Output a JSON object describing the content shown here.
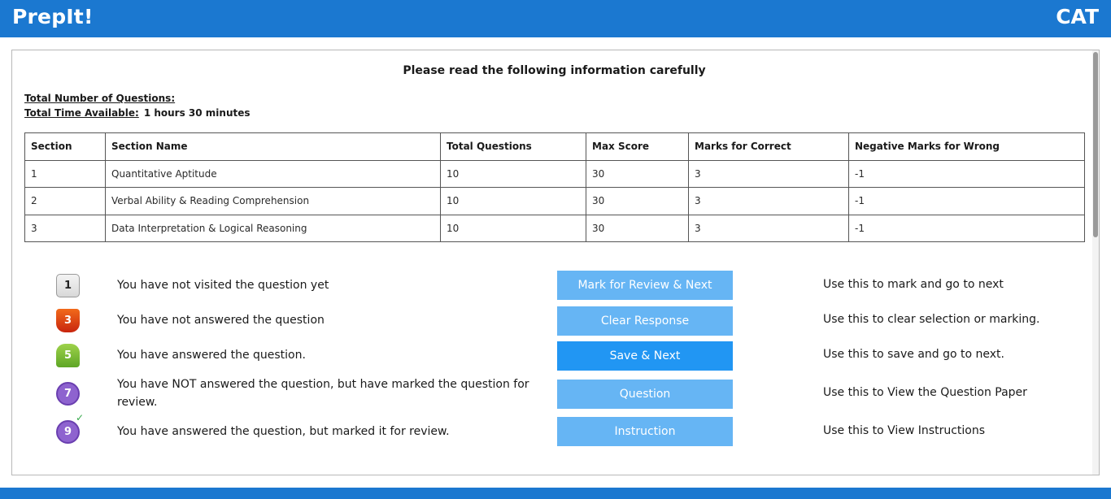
{
  "header": {
    "brand": "PrepIt!",
    "exam": "CAT"
  },
  "panel": {
    "heading": "Please read the following information carefully",
    "total_questions_label": "Total Number of Questions:",
    "total_questions_value": "",
    "total_time_label": "Total Time Available:",
    "total_time_value": "1 hours 30 minutes"
  },
  "table": {
    "headers": [
      "Section",
      "Section Name",
      "Total Questions",
      "Max Score",
      "Marks for Correct",
      "Negative Marks for Wrong"
    ],
    "rows": [
      [
        "1",
        "Quantitative Aptitude",
        "10",
        "30",
        "3",
        "-1"
      ],
      [
        "2",
        "Verbal Ability & Reading Comprehension",
        "10",
        "30",
        "3",
        "-1"
      ],
      [
        "3",
        "Data Interpretation & Logical Reasoning",
        "10",
        "30",
        "3",
        "-1"
      ]
    ]
  },
  "legend": [
    {
      "number": "1",
      "text": "You have not visited the question yet"
    },
    {
      "number": "3",
      "text": "You have not answered the question"
    },
    {
      "number": "5",
      "text": "You have answered the question."
    },
    {
      "number": "7",
      "text": "You have NOT answered the question, but have marked the question for review."
    },
    {
      "number": "9",
      "text": "You have answered the question, but marked it for review.",
      "tick": "✓"
    }
  ],
  "buttons": [
    {
      "label": "Mark for Review & Next",
      "hint": "Use this to mark and go to next"
    },
    {
      "label": "Clear Response",
      "hint": "Use this to clear selection or marking."
    },
    {
      "label": "Save & Next",
      "hint": "Use this to save and go to next."
    },
    {
      "label": "Question",
      "hint": "Use this to View the Question Paper"
    },
    {
      "label": "Instruction",
      "hint": "Use this to View Instructions"
    }
  ],
  "colors": {
    "header": "#1b78d0",
    "button": "#66b5f4",
    "button_primary": "#2196f3",
    "not_answered": "#e1461a",
    "answered": "#7dbf35",
    "marked": "#8e63cf"
  }
}
